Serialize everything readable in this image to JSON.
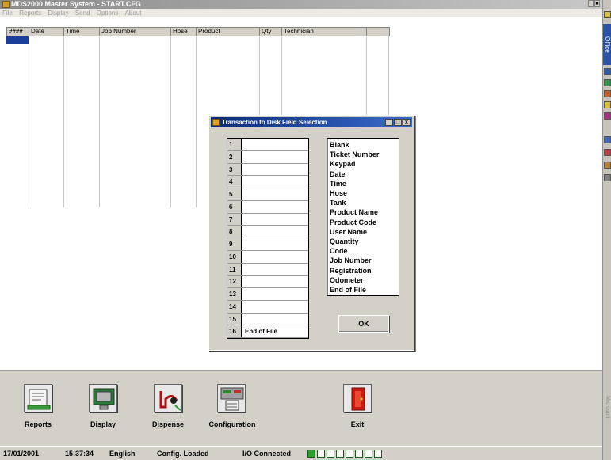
{
  "window": {
    "title": "MDS2000 Master System - START.CFG",
    "controls": [
      "_",
      "■"
    ]
  },
  "menu": [
    "File",
    "Reports",
    "Display",
    "Send",
    "Options",
    "About"
  ],
  "grid": {
    "columns": [
      "####",
      "Date",
      "Time",
      "Job Number",
      "Hose",
      "Product",
      "Qty",
      "Technician",
      ""
    ]
  },
  "office_bar": {
    "label": "Office",
    "footer": "Microsoft"
  },
  "dialog": {
    "title": "Transaction to Disk Field Selection",
    "controls": [
      "_",
      "□",
      "x"
    ],
    "rows": [
      {
        "num": "1",
        "value": ""
      },
      {
        "num": "2",
        "value": ""
      },
      {
        "num": "3",
        "value": ""
      },
      {
        "num": "4",
        "value": ""
      },
      {
        "num": "5",
        "value": ""
      },
      {
        "num": "6",
        "value": ""
      },
      {
        "num": "7",
        "value": ""
      },
      {
        "num": "8",
        "value": ""
      },
      {
        "num": "9",
        "value": ""
      },
      {
        "num": "10",
        "value": ""
      },
      {
        "num": "11",
        "value": ""
      },
      {
        "num": "12",
        "value": ""
      },
      {
        "num": "13",
        "value": ""
      },
      {
        "num": "14",
        "value": ""
      },
      {
        "num": "15",
        "value": ""
      },
      {
        "num": "16",
        "value": "End of File"
      }
    ],
    "options": [
      "Blank",
      "Ticket Number",
      "Keypad",
      "Date",
      "Time",
      "Hose",
      "Tank",
      "Product Name",
      "Product Code",
      "User Name",
      "Quantity",
      "Code",
      "Job Number",
      "Registration",
      "Odometer",
      "End of File"
    ],
    "ok_label": "OK"
  },
  "toolbar": {
    "reports": "Reports",
    "display": "Display",
    "dispense": "Dispense",
    "configuration": "Configuration",
    "exit": "Exit"
  },
  "status": {
    "date": "17/01/2001",
    "time": "15:37:34",
    "language": "English",
    "config": "Config. Loaded",
    "io": "I/O Connected",
    "io_leds": [
      true,
      false,
      false,
      false,
      false,
      false,
      false,
      false
    ]
  },
  "colors": {
    "selection": "#1a3e9a",
    "dialog_title": "#0a2a7a",
    "led_on": "#2aa02a",
    "exit_red": "#cc1a10"
  }
}
